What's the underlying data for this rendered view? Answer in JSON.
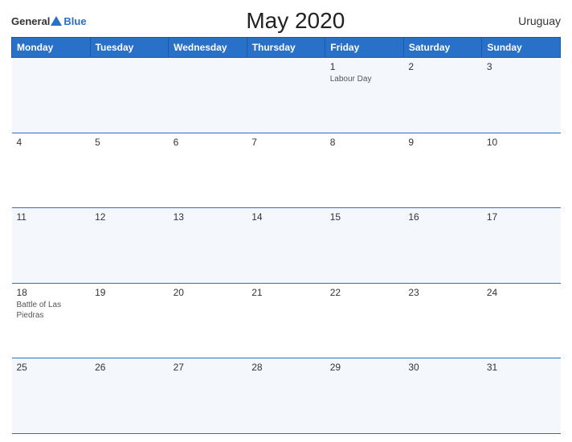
{
  "logo": {
    "general": "General",
    "blue": "Blue"
  },
  "title": "May 2020",
  "country": "Uruguay",
  "headers": [
    "Monday",
    "Tuesday",
    "Wednesday",
    "Thursday",
    "Friday",
    "Saturday",
    "Sunday"
  ],
  "weeks": [
    [
      {
        "day": "",
        "holiday": ""
      },
      {
        "day": "",
        "holiday": ""
      },
      {
        "day": "",
        "holiday": ""
      },
      {
        "day": "",
        "holiday": ""
      },
      {
        "day": "1",
        "holiday": "Labour Day"
      },
      {
        "day": "2",
        "holiday": ""
      },
      {
        "day": "3",
        "holiday": ""
      }
    ],
    [
      {
        "day": "4",
        "holiday": ""
      },
      {
        "day": "5",
        "holiday": ""
      },
      {
        "day": "6",
        "holiday": ""
      },
      {
        "day": "7",
        "holiday": ""
      },
      {
        "day": "8",
        "holiday": ""
      },
      {
        "day": "9",
        "holiday": ""
      },
      {
        "day": "10",
        "holiday": ""
      }
    ],
    [
      {
        "day": "11",
        "holiday": ""
      },
      {
        "day": "12",
        "holiday": ""
      },
      {
        "day": "13",
        "holiday": ""
      },
      {
        "day": "14",
        "holiday": ""
      },
      {
        "day": "15",
        "holiday": ""
      },
      {
        "day": "16",
        "holiday": ""
      },
      {
        "day": "17",
        "holiday": ""
      }
    ],
    [
      {
        "day": "18",
        "holiday": "Battle of Las Piedras"
      },
      {
        "day": "19",
        "holiday": ""
      },
      {
        "day": "20",
        "holiday": ""
      },
      {
        "day": "21",
        "holiday": ""
      },
      {
        "day": "22",
        "holiday": ""
      },
      {
        "day": "23",
        "holiday": ""
      },
      {
        "day": "24",
        "holiday": ""
      }
    ],
    [
      {
        "day": "25",
        "holiday": ""
      },
      {
        "day": "26",
        "holiday": ""
      },
      {
        "day": "27",
        "holiday": ""
      },
      {
        "day": "28",
        "holiday": ""
      },
      {
        "day": "29",
        "holiday": ""
      },
      {
        "day": "30",
        "holiday": ""
      },
      {
        "day": "31",
        "holiday": ""
      }
    ]
  ]
}
